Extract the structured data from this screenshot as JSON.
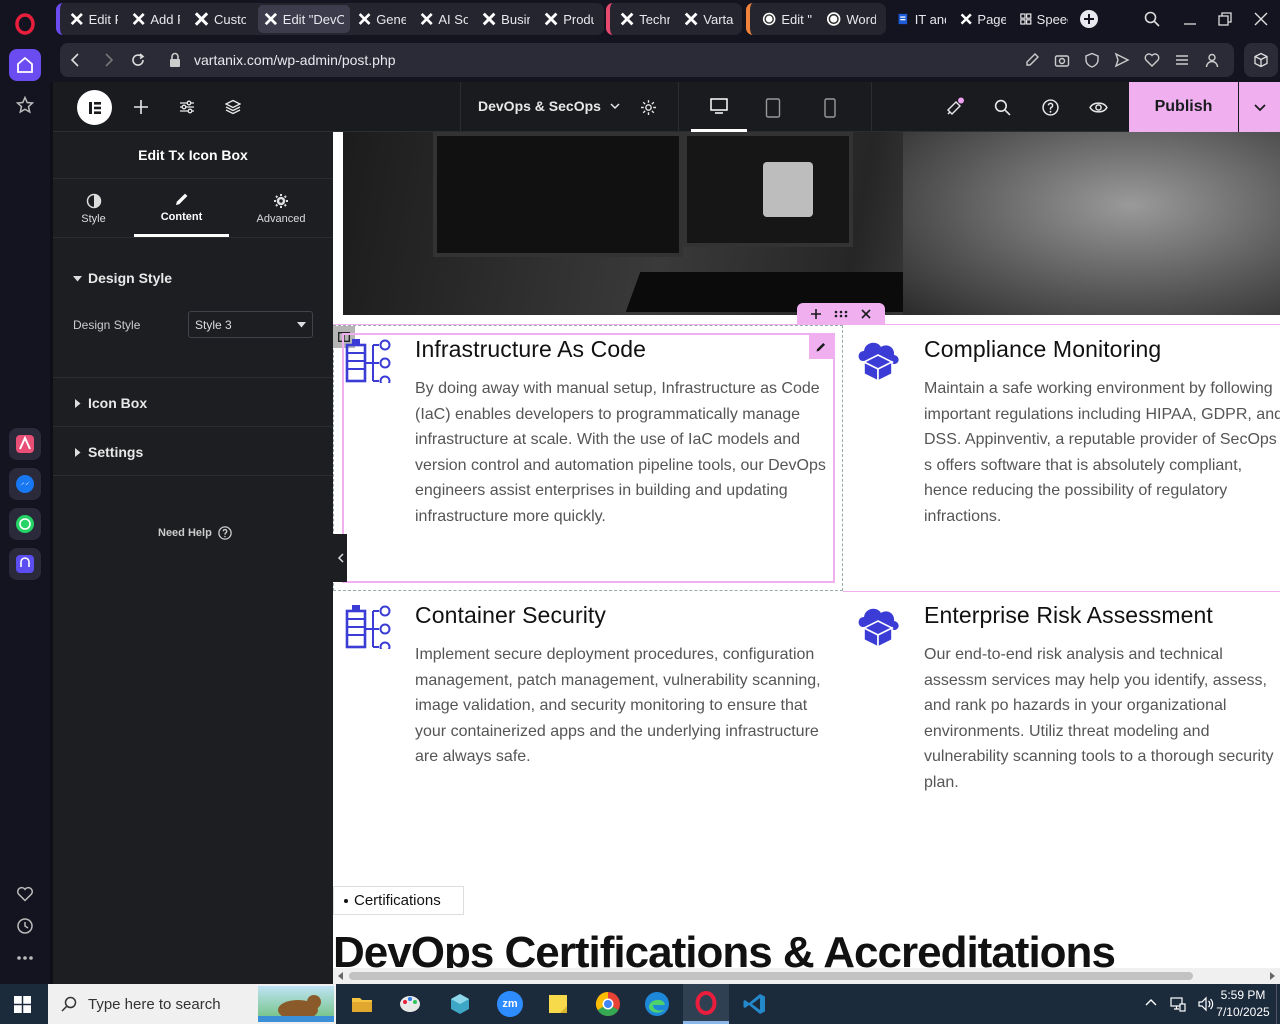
{
  "browser": {
    "tabs": [
      {
        "label": "Edit P",
        "icon": "elementor-x-icon"
      },
      {
        "label": "Add P",
        "icon": "elementor-x-icon"
      },
      {
        "label": "Custo",
        "icon": "elementor-x-icon"
      },
      {
        "label": "Edit \"DevOp",
        "icon": "elementor-x-icon",
        "active": true
      },
      {
        "label": "Gener",
        "icon": "elementor-x-icon"
      },
      {
        "label": "AI Sof",
        "icon": "elementor-x-icon"
      },
      {
        "label": "Busin",
        "icon": "elementor-x-icon"
      },
      {
        "label": "Produ",
        "icon": "elementor-x-icon"
      },
      {
        "label": "Techn",
        "icon": "elementor-x-icon"
      },
      {
        "label": "Vartar",
        "icon": "elementor-x-icon"
      },
      {
        "label": "Edit \"I",
        "icon": "wordpress-icon"
      },
      {
        "label": "Word",
        "icon": "wordpress-icon"
      },
      {
        "label": "IT and",
        "icon": "page-icon"
      },
      {
        "label": "Pages",
        "icon": "elementor-x-icon"
      },
      {
        "label": "Speed",
        "icon": "grid-icon"
      }
    ],
    "url": "vartanix.com/wp-admin/post.php",
    "accent": "#e81e3c"
  },
  "editor": {
    "page_name": "DevOps & SecOps",
    "publish_label": "Publish",
    "publish_color": "#f0b0f0"
  },
  "panel": {
    "title": "Edit Tx Icon Box",
    "tabs": [
      "Style",
      "Content",
      "Advanced"
    ],
    "active_tab": "Content",
    "section_design": "Design Style",
    "design_style_label": "Design Style",
    "design_style_value": "Style 3",
    "section_iconbox": "Icon Box",
    "section_settings": "Settings",
    "need_help": "Need Help"
  },
  "page": {
    "icon_color": "#3b3bd6",
    "boxes": [
      {
        "title": "Infrastructure As Code",
        "desc": "By doing away with manual setup, Infrastructure as Code (IaC) enables developers to programmatically manage infrastructure at scale. With the use of IaC models and version control and automation pipeline tools, our DevOps engineers assist enterprises in building and updating infrastructure more quickly.",
        "icon": "server-tree-icon"
      },
      {
        "title": "Compliance Monitoring",
        "desc": "Maintain a safe working environment by following important regulations including HIPAA, GDPR, and DSS. Appinventiv, a reputable provider of SecOps s offers software that is absolutely compliant, hence reducing the possibility of regulatory infractions.",
        "icon": "cloud-box-icon"
      },
      {
        "title": "Container Security",
        "desc": "Implement secure deployment procedures, configuration management, patch management, vulnerability scanning, image validation, and security monitoring to ensure that your containerized apps and the underlying infrastructure are always safe.",
        "icon": "server-tree-icon"
      },
      {
        "title": "Enterprise Risk Assessment",
        "desc": "Our end-to-end risk analysis and technical assessm services may help you identify, assess, and rank po hazards in your organizational environments. Utiliz threat modeling and vulnerability scanning tools to a thorough security plan.",
        "icon": "cloud-box-icon"
      }
    ],
    "cert_badge": "Certifications",
    "cert_heading": "DevOps Certifications & Accreditations"
  },
  "taskbar": {
    "search_placeholder": "Type here to search",
    "time": "5:59 PM",
    "date": "7/10/2025"
  }
}
